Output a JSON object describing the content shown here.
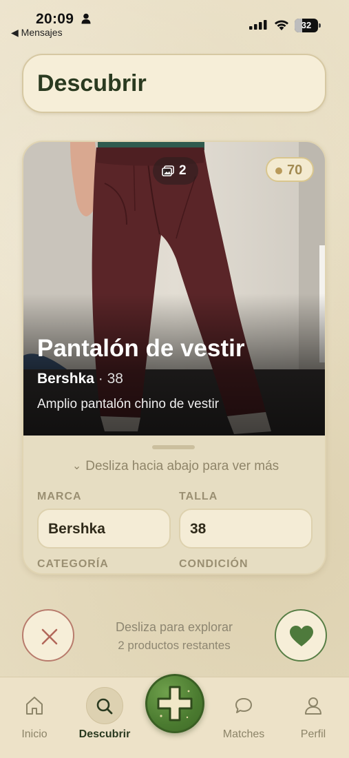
{
  "status_bar": {
    "time": "20:09",
    "back_app": "◀ Mensajes",
    "battery_level": "32"
  },
  "header": {
    "title": "Descubrir"
  },
  "product": {
    "photo_count": "2",
    "points": "70",
    "title": "Pantalón de vestir",
    "brand": "Bershka",
    "separator": " · ",
    "size": "38",
    "description": "Amplio pantalón chino de vestir",
    "swipe_hint": "Desliza hacia abajo para ver más",
    "fields": {
      "brand_label": "MARCA",
      "brand_value": "Bershka",
      "size_label": "TALLA",
      "size_value": "38",
      "category_label": "CATEGORÍA",
      "condition_label": "CONDICIÓN"
    }
  },
  "actions": {
    "explore_text": "Desliza para explorar",
    "remaining_text": "2 productos restantes",
    "reject_icon": "close-icon",
    "like_icon": "heart-icon"
  },
  "tabs": [
    {
      "label": "Inicio",
      "icon": "home-icon"
    },
    {
      "label": "Descubrir",
      "icon": "search-icon",
      "active": true
    },
    {
      "label": "Matches",
      "icon": "chat-icon"
    },
    {
      "label": "Perfil",
      "icon": "user-icon"
    }
  ],
  "colors": {
    "accent_green": "#4b7b30",
    "reject_red": "#b87b6c",
    "background": "#ece3cc"
  }
}
